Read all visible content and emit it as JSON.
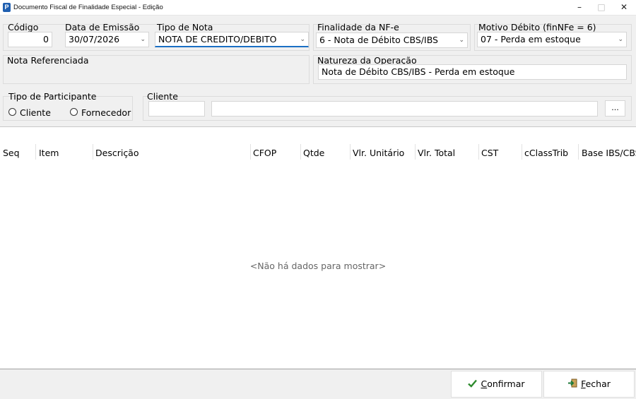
{
  "window": {
    "title": "Documento Fiscal de Finalidade Especial - Edição",
    "minimize": "–",
    "maximize": "□",
    "close": "✕"
  },
  "fields": {
    "codigo": {
      "label": "Código",
      "value": "0"
    },
    "data_emissao": {
      "label": "Data de Emissão",
      "value": "30/07/2026"
    },
    "tipo_nota": {
      "label": "Tipo de Nota",
      "value": "NOTA DE CREDITO/DEBITO"
    },
    "finalidade": {
      "label": "Finalidade da NF-e",
      "value": "6 - Nota de Débito CBS/IBS"
    },
    "motivo": {
      "label": "Motivo Débito (finNFe = 6)",
      "value": "07 - Perda em estoque"
    },
    "nota_referenciada": {
      "label": "Nota Referenciada"
    },
    "natureza": {
      "label": "Natureza da Operação",
      "value": "Nota de Débito CBS/IBS - Perda em estoque"
    }
  },
  "participante": {
    "label": "Tipo de Participante",
    "options": [
      "Cliente",
      "Fornecedor"
    ]
  },
  "cliente": {
    "label": "Cliente",
    "code": "",
    "name": "",
    "browse": "..."
  },
  "grid": {
    "columns": [
      "Seq",
      "Item",
      "Descrição",
      "CFOP",
      "Qtde",
      "Vlr. Unitário",
      "Vlr. Total",
      "CST",
      "cClassTrib",
      "Base IBS/CBS"
    ],
    "empty_text": "<Não há dados para mostrar>"
  },
  "buttons": {
    "confirmar": {
      "hotkey": "C",
      "rest": "onfirmar",
      "icon": "checkmark-icon",
      "color": "#2e8b2e"
    },
    "fechar": {
      "hotkey": "F",
      "rest": "echar",
      "icon": "exit-door-icon",
      "color": "#1f7a3a"
    }
  }
}
